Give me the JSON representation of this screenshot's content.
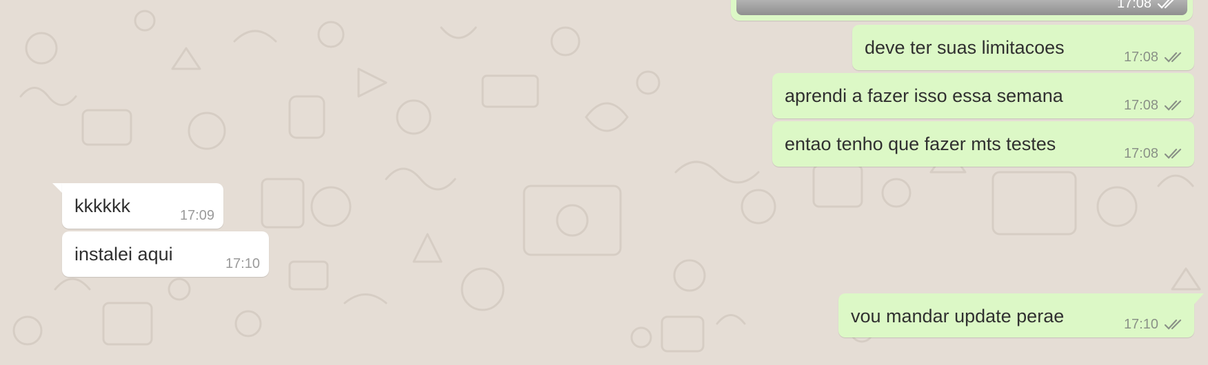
{
  "chat": {
    "colors": {
      "wallpaper": "#e5ddd5",
      "outgoing_bubble": "#dcf8c6",
      "incoming_bubble": "#ffffff",
      "read_ticks": "#8a9187"
    },
    "top_media_time": "17:08",
    "messages": [
      {
        "direction": "outgoing",
        "text": "deve ter suas limitacoes",
        "time": "17:08",
        "status_icon": "double-check-icon"
      },
      {
        "direction": "outgoing",
        "text": "aprendi a fazer isso essa semana",
        "time": "17:08",
        "status_icon": "double-check-icon"
      },
      {
        "direction": "outgoing",
        "text": "entao tenho que fazer mts testes",
        "time": "17:08",
        "status_icon": "double-check-icon"
      },
      {
        "direction": "incoming",
        "text": "kkkkkk",
        "time": "17:09"
      },
      {
        "direction": "incoming",
        "text": "instalei aqui",
        "time": "17:10"
      },
      {
        "direction": "outgoing",
        "text": "vou mandar update perae",
        "time": "17:10",
        "status_icon": "double-check-icon"
      }
    ]
  }
}
